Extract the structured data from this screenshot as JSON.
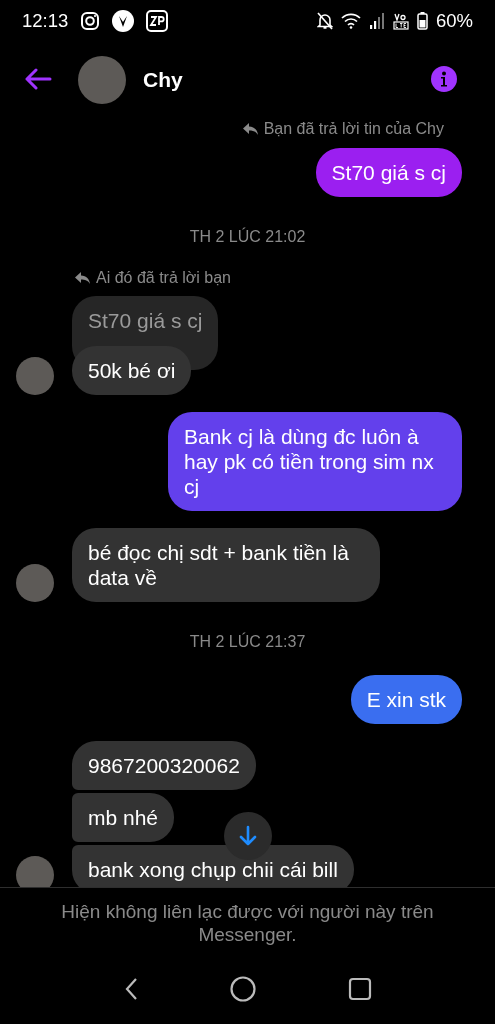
{
  "status_bar": {
    "time": "12:13",
    "battery": "60%"
  },
  "header": {
    "name": "Chy"
  },
  "messages": [
    {
      "kind": "sent_reply_note",
      "text": "Bạn đã trả lời tin của Chy"
    },
    {
      "kind": "sent",
      "text": "St70 giá s cj",
      "color": "#9b1ff0"
    },
    {
      "kind": "timestamp",
      "text": "TH 2 LÚC 21:02"
    },
    {
      "kind": "received_reply_note",
      "text": "Ai đó đã trả lời bạn"
    },
    {
      "kind": "quote",
      "text": "St70 giá s cj"
    },
    {
      "kind": "received",
      "text": "50k bé ơi",
      "avatar": true
    },
    {
      "kind": "sent",
      "text": "Bank cj là dùng đc luôn à hay pk có tiền trong sim nx cj",
      "color": "#6340ec"
    },
    {
      "kind": "received",
      "text": "bé đọc chị sdt + bank tiền là data về",
      "avatar": true
    },
    {
      "kind": "timestamp",
      "text": "TH 2 LÚC 21:37"
    },
    {
      "kind": "sent",
      "text": "E xin stk",
      "color": "#3a6ef0"
    },
    {
      "kind": "received",
      "text": "9867200320062",
      "avatar": false
    },
    {
      "kind": "received",
      "text": "mb nhé",
      "avatar": false
    },
    {
      "kind": "received",
      "text": "bank xong chụp chii cái bill",
      "avatar": true
    }
  ],
  "notice": "Hiện không liên lạc được với người này trên Messenger."
}
